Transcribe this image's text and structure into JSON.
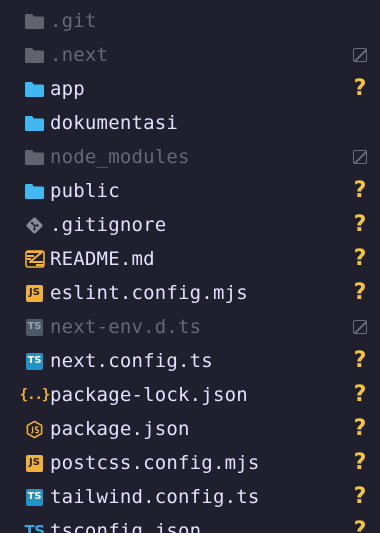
{
  "explorer": {
    "items": [
      {
        "name": ".git",
        "icon": "folder-icon",
        "dimmed": true,
        "status": "none"
      },
      {
        "name": ".next",
        "icon": "folder-icon",
        "dimmed": true,
        "status": "ignored"
      },
      {
        "name": "app",
        "icon": "folder-icon",
        "dimmed": false,
        "status": "untracked"
      },
      {
        "name": "dokumentasi",
        "icon": "folder-icon",
        "dimmed": false,
        "status": "none"
      },
      {
        "name": "node_modules",
        "icon": "folder-icon",
        "dimmed": true,
        "status": "ignored"
      },
      {
        "name": "public",
        "icon": "folder-icon",
        "dimmed": false,
        "status": "untracked"
      },
      {
        "name": ".gitignore",
        "icon": "git-icon",
        "dimmed": false,
        "status": "untracked"
      },
      {
        "name": "README.md",
        "icon": "readme-icon",
        "dimmed": false,
        "status": "untracked"
      },
      {
        "name": "eslint.config.mjs",
        "icon": "javascript-icon",
        "dimmed": false,
        "status": "untracked"
      },
      {
        "name": "next-env.d.ts",
        "icon": "typescript-icon",
        "dimmed": true,
        "status": "ignored"
      },
      {
        "name": "next.config.ts",
        "icon": "typescript-icon",
        "dimmed": false,
        "status": "untracked"
      },
      {
        "name": "package-lock.json",
        "icon": "json-icon",
        "dimmed": false,
        "status": "untracked"
      },
      {
        "name": "package.json",
        "icon": "nodejs-icon",
        "dimmed": false,
        "status": "untracked"
      },
      {
        "name": "postcss.config.mjs",
        "icon": "javascript-icon",
        "dimmed": false,
        "status": "untracked"
      },
      {
        "name": "tailwind.config.ts",
        "icon": "typescript-icon",
        "dimmed": false,
        "status": "untracked"
      },
      {
        "name": "tsconfig.json",
        "icon": "tsconfig-icon",
        "dimmed": false,
        "status": "untracked"
      }
    ],
    "untracked_symbol": "?",
    "icon_text": {
      "js": "JS",
      "ts": "TS",
      "json": "{..}"
    },
    "colors": {
      "background": "#1f1f2e",
      "folder_open": "#41b8f0",
      "folder_dim": "#63636f",
      "text": "#e2e1ff",
      "text_dim": "#676778",
      "untracked": "#f2c53d"
    }
  }
}
